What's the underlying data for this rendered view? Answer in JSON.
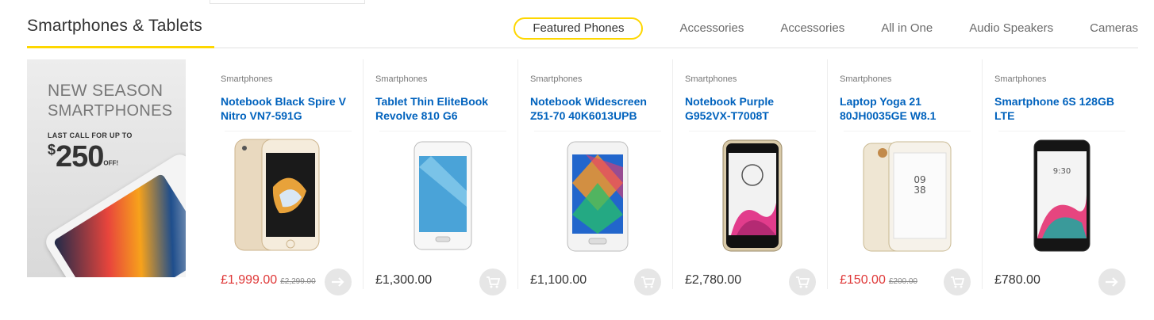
{
  "section": {
    "title": "Smartphones & Tablets",
    "accent_color": "#fed700",
    "tabs": [
      {
        "label": "Featured Phones",
        "active": true
      },
      {
        "label": "Accessories",
        "active": false
      },
      {
        "label": "Accessories",
        "active": false
      },
      {
        "label": "All in One",
        "active": false
      },
      {
        "label": "Audio Speakers",
        "active": false
      },
      {
        "label": "Cameras",
        "active": false
      }
    ]
  },
  "banner": {
    "line1": "NEW SEASON",
    "line2": "SMARTPHONES",
    "small": "LAST CALL FOR UP TO",
    "currency": "$",
    "amount": "250",
    "suffix": "OFF!"
  },
  "products": [
    {
      "category": "Smartphones",
      "name": "Notebook Black Spire V Nitro VN7-591G",
      "price": "£1,999.00",
      "old_price": "£2,299.00",
      "on_sale": true,
      "button_icon": "arrow-right-icon",
      "image": "gold-iphone"
    },
    {
      "category": "Smartphones",
      "name": "Tablet Thin EliteBook Revolve 810 G6",
      "price": "£1,300.00",
      "old_price": "",
      "on_sale": false,
      "button_icon": "add-to-cart-icon",
      "image": "white-galaxy-j"
    },
    {
      "category": "Smartphones",
      "name": "Notebook Widescreen Z51-70 40K6013UPB",
      "price": "£1,100.00",
      "old_price": "",
      "on_sale": false,
      "button_icon": "add-to-cart-icon",
      "image": "white-galaxy-grand"
    },
    {
      "category": "Smartphones",
      "name": "Notebook Purple G952VX-T7008T",
      "price": "£2,780.00",
      "old_price": "",
      "on_sale": false,
      "button_icon": "add-to-cart-icon",
      "image": "lg-g3-beat"
    },
    {
      "category": "Smartphones",
      "name": "Laptop Yoga 21 80JH0035GE W8.1",
      "price": "£150.00",
      "old_price": "£200.00",
      "on_sale": true,
      "button_icon": "add-to-cart-icon",
      "image": "lg-v10-white"
    },
    {
      "category": "Smartphones",
      "name": "Smartphone 6S 128GB LTE",
      "price": "£780.00",
      "old_price": "",
      "on_sale": false,
      "button_icon": "arrow-right-icon",
      "image": "black-lg-g4c"
    }
  ]
}
